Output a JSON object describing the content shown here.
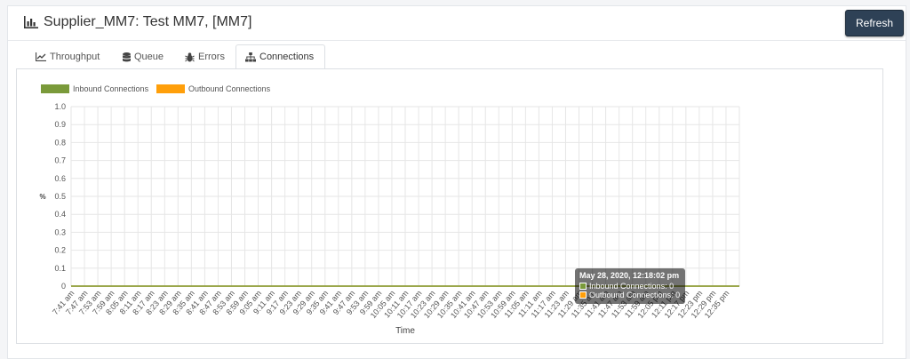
{
  "header": {
    "title": "Supplier_MM7: Test MM7, [MM7]",
    "title_icon": "bar-chart-icon",
    "refresh_label": "Refresh"
  },
  "tabs": [
    {
      "label": "Throughput",
      "icon": "line-chart-icon",
      "active": false
    },
    {
      "label": "Queue",
      "icon": "database-icon",
      "active": false
    },
    {
      "label": "Errors",
      "icon": "bug-icon",
      "active": false
    },
    {
      "label": "Connections",
      "icon": "sitemap-icon",
      "active": true
    }
  ],
  "chart_data": {
    "type": "line",
    "xlabel": "Time",
    "ylabel": "%",
    "ylim": [
      0,
      1.0
    ],
    "y_ticks": [
      "0",
      "0.1",
      "0.2",
      "0.3",
      "0.4",
      "0.5",
      "0.6",
      "0.7",
      "0.8",
      "0.9",
      "1.0"
    ],
    "categories": [
      "7:41 am",
      "7:47 am",
      "7:53 am",
      "7:59 am",
      "8:05 am",
      "8:11 am",
      "8:17 am",
      "8:23 am",
      "8:29 am",
      "8:35 am",
      "8:41 am",
      "8:47 am",
      "8:53 am",
      "8:59 am",
      "9:05 am",
      "9:11 am",
      "9:17 am",
      "9:23 am",
      "9:29 am",
      "9:35 am",
      "9:41 am",
      "9:47 am",
      "9:53 am",
      "9:59 am",
      "10:05 am",
      "10:11 am",
      "10:17 am",
      "10:23 am",
      "10:29 am",
      "10:35 am",
      "10:41 am",
      "10:47 am",
      "10:53 am",
      "10:59 am",
      "11:05 am",
      "11:11 am",
      "11:17 am",
      "11:23 am",
      "11:29 am",
      "11:35 am",
      "11:41 am",
      "11:47 am",
      "11:53 am",
      "11:59 am",
      "12:05 pm",
      "12:11 pm",
      "12:17 pm",
      "12:23 pm",
      "12:29 pm",
      "12:35 pm"
    ],
    "series": [
      {
        "name": "Inbound Connections",
        "color": "#7a9a3a",
        "values": [
          0,
          0,
          0,
          0,
          0,
          0,
          0,
          0,
          0,
          0,
          0,
          0,
          0,
          0,
          0,
          0,
          0,
          0,
          0,
          0,
          0,
          0,
          0,
          0,
          0,
          0,
          0,
          0,
          0,
          0,
          0,
          0,
          0,
          0,
          0,
          0,
          0,
          0,
          0,
          0,
          0,
          0,
          0,
          0,
          0,
          0,
          0,
          0,
          0,
          0
        ]
      },
      {
        "name": "Outbound Connections",
        "color": "#ff9f0a",
        "values": [
          0,
          0,
          0,
          0,
          0,
          0,
          0,
          0,
          0,
          0,
          0,
          0,
          0,
          0,
          0,
          0,
          0,
          0,
          0,
          0,
          0,
          0,
          0,
          0,
          0,
          0,
          0,
          0,
          0,
          0,
          0,
          0,
          0,
          0,
          0,
          0,
          0,
          0,
          0,
          0,
          0,
          0,
          0,
          0,
          0,
          0,
          0,
          0,
          0,
          0
        ]
      }
    ],
    "legend_position": "top-left",
    "grid": true,
    "tooltip": {
      "title": "May 28, 2020, 12:18:02 pm",
      "rows": [
        "Inbound Connections: 0",
        "Outbound Connections: 0"
      ]
    }
  }
}
